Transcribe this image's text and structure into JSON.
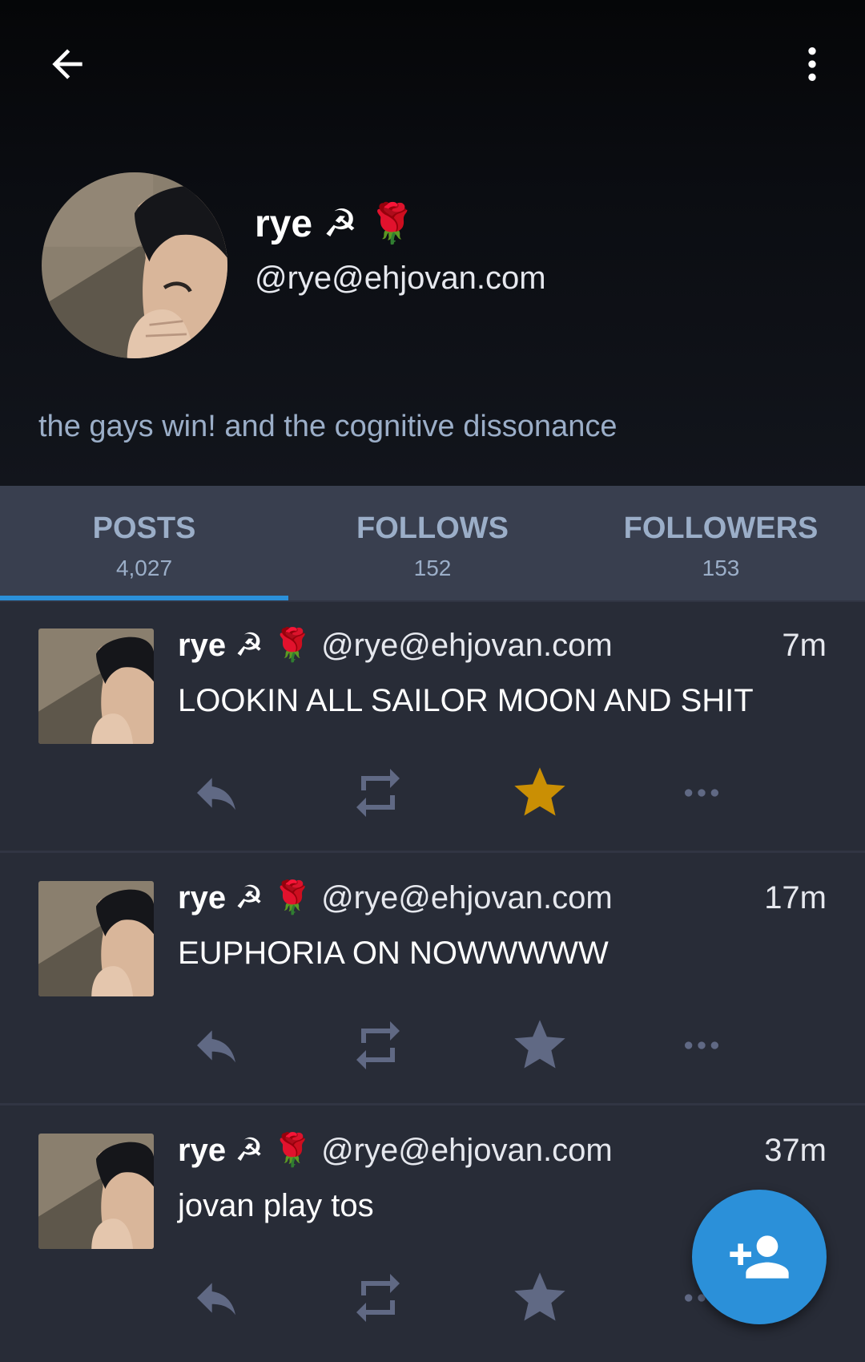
{
  "toolbar": {
    "back_icon": "arrow-left-icon",
    "menu_icon": "more-vertical-icon"
  },
  "profile": {
    "display_name": "rye ☭ 🌹",
    "account": "@rye@ehjovan.com",
    "bio": "the gays win! and the cognitive dissonance"
  },
  "tabs": [
    {
      "label": "POSTS",
      "count": "4,027",
      "active": true
    },
    {
      "label": "FOLLOWS",
      "count": "152",
      "active": false
    },
    {
      "label": "FOLLOWERS",
      "count": "153",
      "active": false
    }
  ],
  "posts": [
    {
      "display_name": "rye ☭ 🌹",
      "account": "@rye@ehjovan.com",
      "time": "7m",
      "content": "LOOKIN ALL SAILOR MOON AND SHIT",
      "favourited": true
    },
    {
      "display_name": "rye ☭ 🌹",
      "account": "@rye@ehjovan.com",
      "time": "17m",
      "content": "EUPHORIA ON NOWWWWW",
      "favourited": false
    },
    {
      "display_name": "rye ☭ 🌹",
      "account": "@rye@ehjovan.com",
      "time": "37m",
      "content": "jovan play tos",
      "favourited": false
    }
  ],
  "fab": {
    "icon": "follow-user-icon"
  },
  "colors": {
    "accent": "#2b90d9",
    "favourite": "#ca8f04",
    "action_idle": "#606984",
    "secondary_text": "#9baec8",
    "background": "#282c37",
    "tabs_background": "#393f4f"
  }
}
